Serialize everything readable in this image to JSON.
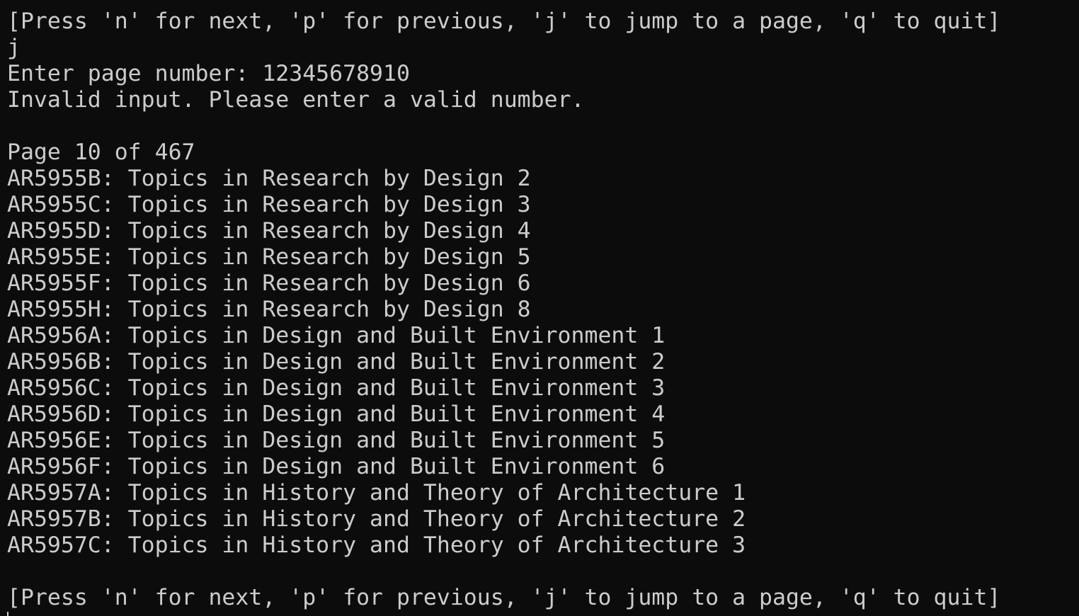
{
  "prompt_top": "[Press 'n' for next, 'p' for previous, 'j' to jump to a page, 'q' to quit]",
  "user_key": "j",
  "page_prompt": "Enter page number: 12345678910",
  "error_message": "Invalid input. Please enter a valid number.",
  "page_indicator": "Page 10 of 467",
  "courses": [
    "AR5955B: Topics in Research by Design 2",
    "AR5955C: Topics in Research by Design 3",
    "AR5955D: Topics in Research by Design 4",
    "AR5955E: Topics in Research by Design 5",
    "AR5955F: Topics in Research by Design 6",
    "AR5955H: Topics in Research by Design 8",
    "AR5956A: Topics in Design and Built Environment 1",
    "AR5956B: Topics in Design and Built Environment 2",
    "AR5956C: Topics in Design and Built Environment 3",
    "AR5956D: Topics in Design and Built Environment 4",
    "AR5956E: Topics in Design and Built Environment 5",
    "AR5956F: Topics in Design and Built Environment 6",
    "AR5957A: Topics in History and Theory of Architecture 1",
    "AR5957B: Topics in History and Theory of Architecture 2",
    "AR5957C: Topics in History and Theory of Architecture 3"
  ],
  "prompt_bottom": "[Press 'n' for next, 'p' for previous, 'j' to jump to a page, 'q' to quit]",
  "colors": {
    "background": "#0c0c0c",
    "foreground": "#cccccc"
  }
}
